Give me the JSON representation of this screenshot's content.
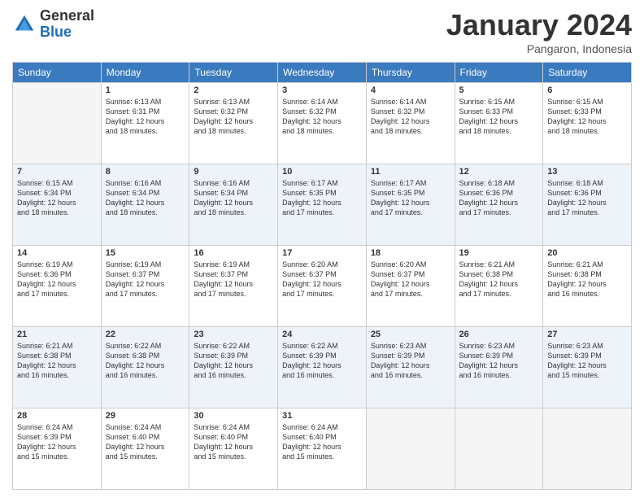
{
  "header": {
    "logo_general": "General",
    "logo_blue": "Blue",
    "title": "January 2024",
    "location": "Pangaron, Indonesia"
  },
  "days_header": [
    "Sunday",
    "Monday",
    "Tuesday",
    "Wednesday",
    "Thursday",
    "Friday",
    "Saturday"
  ],
  "weeks": [
    [
      {
        "num": "",
        "info": ""
      },
      {
        "num": "1",
        "info": "Sunrise: 6:13 AM\nSunset: 6:31 PM\nDaylight: 12 hours\nand 18 minutes."
      },
      {
        "num": "2",
        "info": "Sunrise: 6:13 AM\nSunset: 6:32 PM\nDaylight: 12 hours\nand 18 minutes."
      },
      {
        "num": "3",
        "info": "Sunrise: 6:14 AM\nSunset: 6:32 PM\nDaylight: 12 hours\nand 18 minutes."
      },
      {
        "num": "4",
        "info": "Sunrise: 6:14 AM\nSunset: 6:32 PM\nDaylight: 12 hours\nand 18 minutes."
      },
      {
        "num": "5",
        "info": "Sunrise: 6:15 AM\nSunset: 6:33 PM\nDaylight: 12 hours\nand 18 minutes."
      },
      {
        "num": "6",
        "info": "Sunrise: 6:15 AM\nSunset: 6:33 PM\nDaylight: 12 hours\nand 18 minutes."
      }
    ],
    [
      {
        "num": "7",
        "info": "Sunrise: 6:15 AM\nSunset: 6:34 PM\nDaylight: 12 hours\nand 18 minutes."
      },
      {
        "num": "8",
        "info": "Sunrise: 6:16 AM\nSunset: 6:34 PM\nDaylight: 12 hours\nand 18 minutes."
      },
      {
        "num": "9",
        "info": "Sunrise: 6:16 AM\nSunset: 6:34 PM\nDaylight: 12 hours\nand 18 minutes."
      },
      {
        "num": "10",
        "info": "Sunrise: 6:17 AM\nSunset: 6:35 PM\nDaylight: 12 hours\nand 17 minutes."
      },
      {
        "num": "11",
        "info": "Sunrise: 6:17 AM\nSunset: 6:35 PM\nDaylight: 12 hours\nand 17 minutes."
      },
      {
        "num": "12",
        "info": "Sunrise: 6:18 AM\nSunset: 6:36 PM\nDaylight: 12 hours\nand 17 minutes."
      },
      {
        "num": "13",
        "info": "Sunrise: 6:18 AM\nSunset: 6:36 PM\nDaylight: 12 hours\nand 17 minutes."
      }
    ],
    [
      {
        "num": "14",
        "info": "Sunrise: 6:19 AM\nSunset: 6:36 PM\nDaylight: 12 hours\nand 17 minutes."
      },
      {
        "num": "15",
        "info": "Sunrise: 6:19 AM\nSunset: 6:37 PM\nDaylight: 12 hours\nand 17 minutes."
      },
      {
        "num": "16",
        "info": "Sunrise: 6:19 AM\nSunset: 6:37 PM\nDaylight: 12 hours\nand 17 minutes."
      },
      {
        "num": "17",
        "info": "Sunrise: 6:20 AM\nSunset: 6:37 PM\nDaylight: 12 hours\nand 17 minutes."
      },
      {
        "num": "18",
        "info": "Sunrise: 6:20 AM\nSunset: 6:37 PM\nDaylight: 12 hours\nand 17 minutes."
      },
      {
        "num": "19",
        "info": "Sunrise: 6:21 AM\nSunset: 6:38 PM\nDaylight: 12 hours\nand 17 minutes."
      },
      {
        "num": "20",
        "info": "Sunrise: 6:21 AM\nSunset: 6:38 PM\nDaylight: 12 hours\nand 16 minutes."
      }
    ],
    [
      {
        "num": "21",
        "info": "Sunrise: 6:21 AM\nSunset: 6:38 PM\nDaylight: 12 hours\nand 16 minutes."
      },
      {
        "num": "22",
        "info": "Sunrise: 6:22 AM\nSunset: 6:38 PM\nDaylight: 12 hours\nand 16 minutes."
      },
      {
        "num": "23",
        "info": "Sunrise: 6:22 AM\nSunset: 6:39 PM\nDaylight: 12 hours\nand 16 minutes."
      },
      {
        "num": "24",
        "info": "Sunrise: 6:22 AM\nSunset: 6:39 PM\nDaylight: 12 hours\nand 16 minutes."
      },
      {
        "num": "25",
        "info": "Sunrise: 6:23 AM\nSunset: 6:39 PM\nDaylight: 12 hours\nand 16 minutes."
      },
      {
        "num": "26",
        "info": "Sunrise: 6:23 AM\nSunset: 6:39 PM\nDaylight: 12 hours\nand 16 minutes."
      },
      {
        "num": "27",
        "info": "Sunrise: 6:23 AM\nSunset: 6:39 PM\nDaylight: 12 hours\nand 15 minutes."
      }
    ],
    [
      {
        "num": "28",
        "info": "Sunrise: 6:24 AM\nSunset: 6:39 PM\nDaylight: 12 hours\nand 15 minutes."
      },
      {
        "num": "29",
        "info": "Sunrise: 6:24 AM\nSunset: 6:40 PM\nDaylight: 12 hours\nand 15 minutes."
      },
      {
        "num": "30",
        "info": "Sunrise: 6:24 AM\nSunset: 6:40 PM\nDaylight: 12 hours\nand 15 minutes."
      },
      {
        "num": "31",
        "info": "Sunrise: 6:24 AM\nSunset: 6:40 PM\nDaylight: 12 hours\nand 15 minutes."
      },
      {
        "num": "",
        "info": ""
      },
      {
        "num": "",
        "info": ""
      },
      {
        "num": "",
        "info": ""
      }
    ]
  ]
}
